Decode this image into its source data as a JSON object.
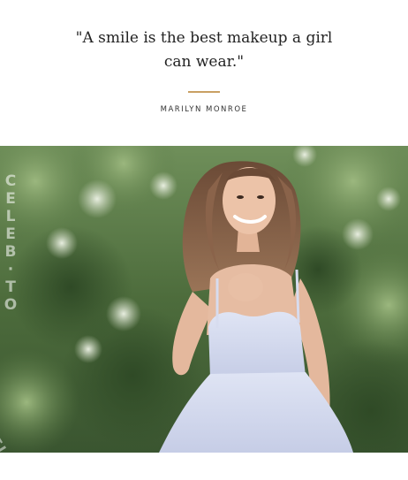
{
  "quote": {
    "line1": "\"A smile is the best makeup a girl",
    "line2": "can wear.\"",
    "author": "MARILYN MONROE",
    "accent_color": "#c9a063"
  },
  "photo": {
    "description_icon": "portrait-photo",
    "watermark_vertical": [
      "C",
      "E",
      "L",
      "E",
      "B",
      "·",
      "T",
      "O"
    ],
    "watermark_diagonal": "CELEB"
  }
}
